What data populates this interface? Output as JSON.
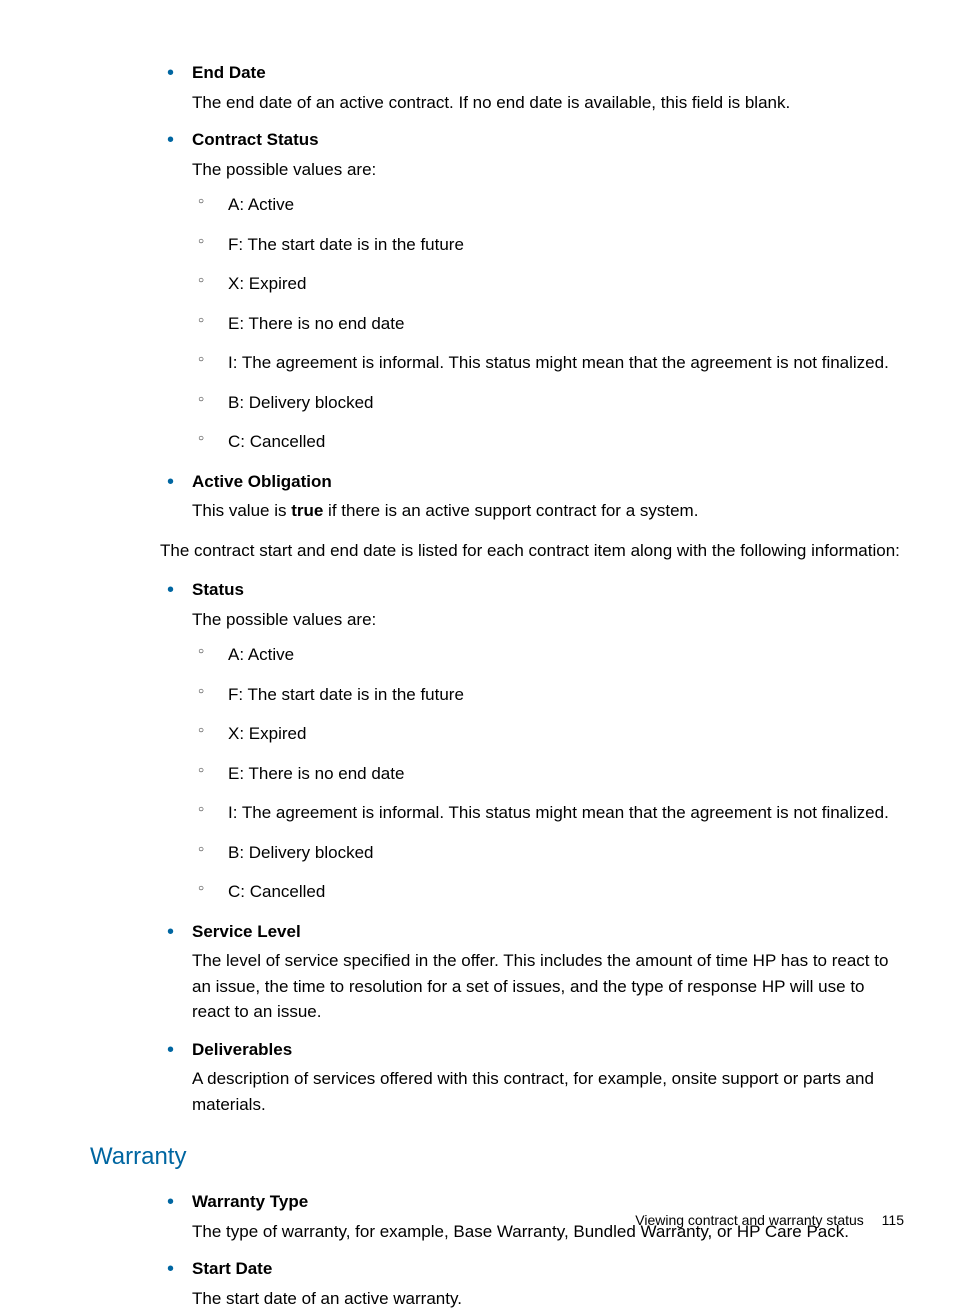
{
  "items1": [
    {
      "title": "End Date",
      "desc": "The end date of an active contract. If no end date is available, this field is blank."
    },
    {
      "title": "Contract Status",
      "desc": "The possible values are:",
      "subitems": [
        "A: Active",
        "F: The start date is in the future",
        "X: Expired",
        "E: There is no end date",
        "I: The agreement is informal. This status might mean that the agreement is not finalized.",
        "B: Delivery blocked",
        "C: Cancelled"
      ]
    },
    {
      "title": "Active Obligation",
      "desc_pre": "This value is ",
      "desc_bold": "true",
      "desc_post": " if there is an active support contract for a system."
    }
  ],
  "mid_paragraph": "The contract start and end date is listed for each contract item along with the following information:",
  "items2": [
    {
      "title": "Status",
      "desc": "The possible values are:",
      "subitems": [
        "A: Active",
        "F: The start date is in the future",
        "X: Expired",
        "E: There is no end date",
        "I: The agreement is informal. This status might mean that the agreement is not finalized.",
        "B: Delivery blocked",
        "C: Cancelled"
      ]
    },
    {
      "title": "Service Level",
      "desc": "The level of service specified in the offer. This includes the amount of time HP has to react to an issue, the time to resolution for a set of issues, and the type of response HP will use to react to an issue."
    },
    {
      "title": "Deliverables",
      "desc": "A description of services offered with this contract, for example, onsite support or parts and materials."
    }
  ],
  "warranty_heading": "Warranty",
  "items3": [
    {
      "title": "Warranty Type",
      "desc": "The type of warranty, for example, Base Warranty, Bundled Warranty, or HP Care Pack."
    },
    {
      "title": "Start Date",
      "desc": "The start date of an active warranty."
    }
  ],
  "footer_text": "Viewing contract and warranty status",
  "page_number": "115"
}
